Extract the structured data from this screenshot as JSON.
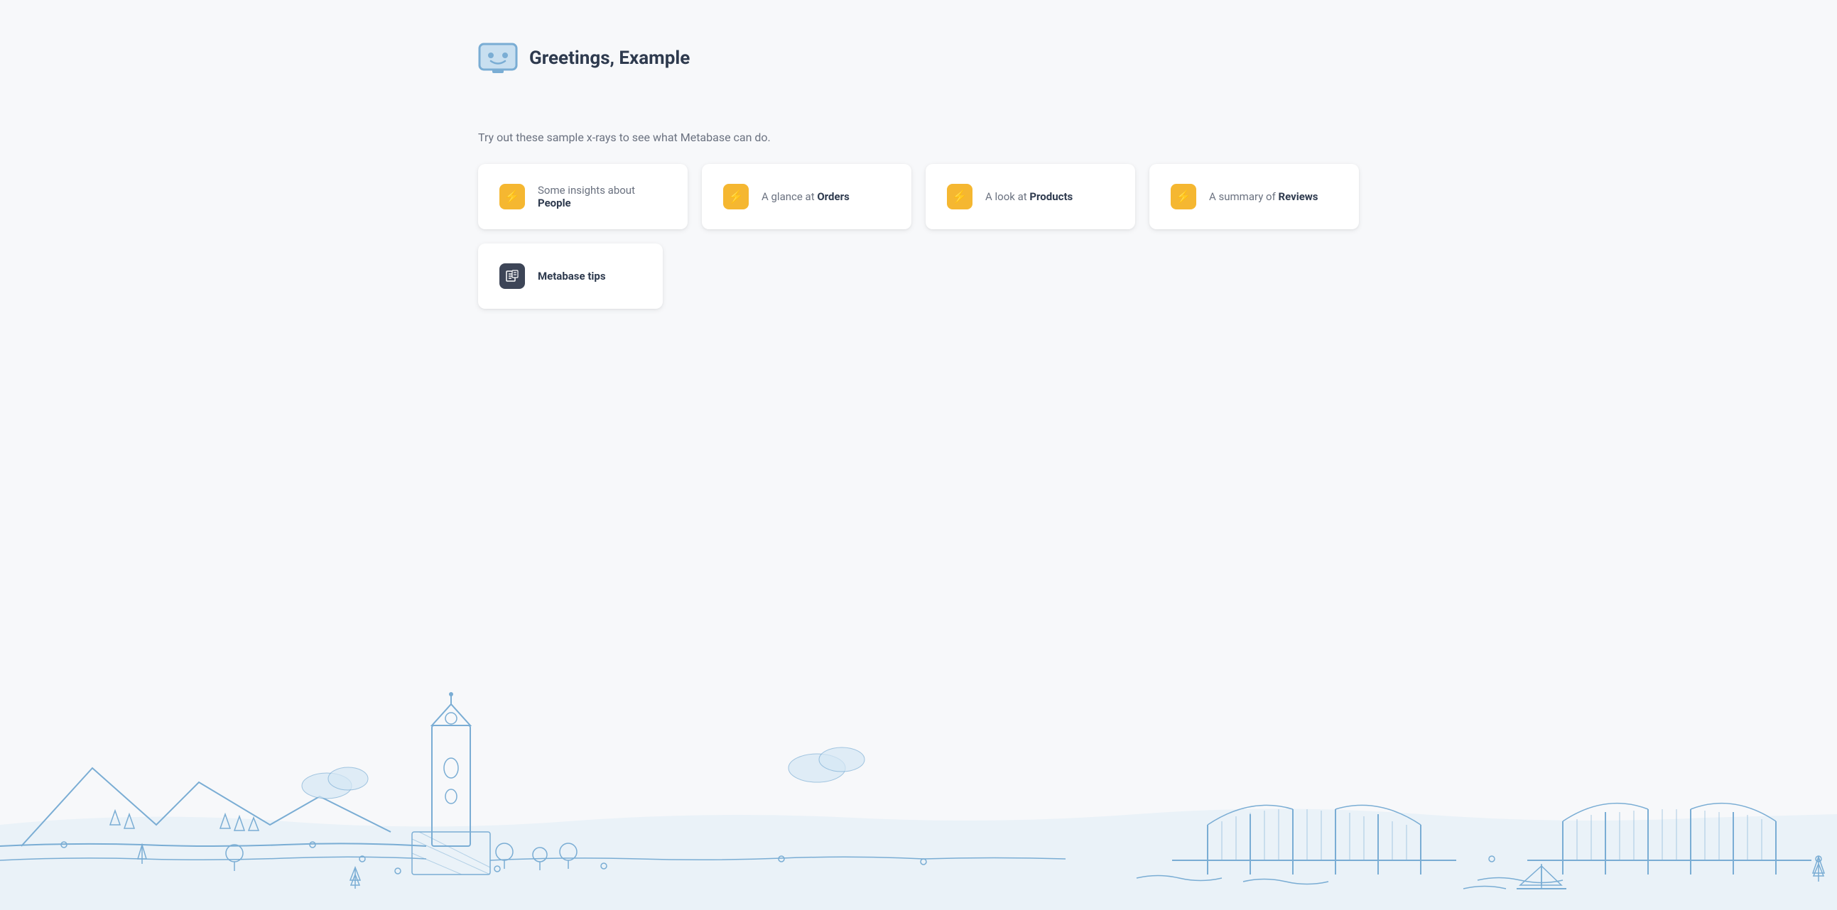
{
  "header": {
    "greeting": "Greetings, Example"
  },
  "subtitle": "Try out these sample x-rays to see what Metabase can do.",
  "cards": [
    {
      "id": "people",
      "prefix": "Some insights about ",
      "bold": "People",
      "icon": "⚡"
    },
    {
      "id": "orders",
      "prefix": "A glance at ",
      "bold": "Orders",
      "icon": "⚡"
    },
    {
      "id": "products",
      "prefix": "A look at ",
      "bold": "Products",
      "icon": "⚡"
    },
    {
      "id": "reviews",
      "prefix": "A summary of ",
      "bold": "Reviews",
      "icon": "⚡"
    }
  ],
  "tips": {
    "label": "Metabase tips",
    "icon": "📋"
  },
  "colors": {
    "background": "#f7f8fa",
    "card_bg": "#ffffff",
    "icon_yellow": "#f5b731",
    "icon_dark": "#3d4557",
    "illustration_stroke": "#7aadd4",
    "illustration_fill": "#d6e8f5"
  }
}
